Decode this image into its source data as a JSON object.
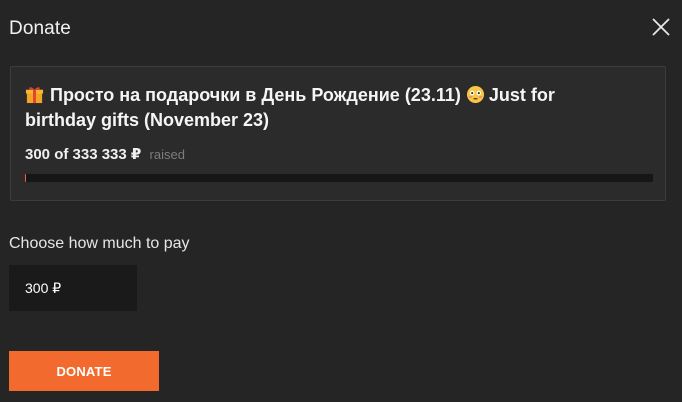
{
  "dialog": {
    "title": "Donate",
    "close_icon": "close-icon"
  },
  "goal": {
    "leading_icon": "gift-emoji-icon",
    "title_ru": "Просто на подарочки в День Рождение (23.11)",
    "middle_icon": "flushed-face-emoji-icon",
    "title_en": "Just for birthday gifts (November 23)",
    "raised_amount": "300 of 333 333 ₽",
    "raised_suffix": "raised",
    "progress_fraction": 0.0009
  },
  "payment": {
    "label": "Choose how much to pay",
    "amount_value": "300 ₽"
  },
  "actions": {
    "donate_label": "DONATE"
  },
  "colors": {
    "background": "#252525",
    "card_background": "#2b2b2b",
    "accent": "#f26a2e",
    "input_background": "#1a1a1a",
    "muted_text": "#7d7d7d"
  }
}
